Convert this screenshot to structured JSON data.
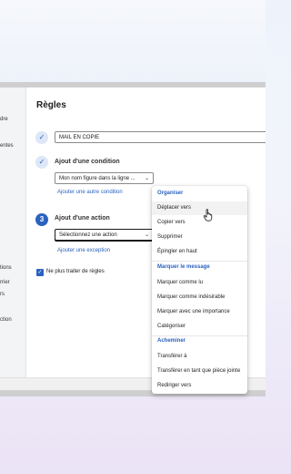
{
  "page": {
    "title": "Règles"
  },
  "left_pane": {
    "fragments": [
      "dre",
      "entes",
      "tions",
      "rrier",
      "rs",
      "ction"
    ]
  },
  "rule_name": {
    "value": "MAIL EN COPIE"
  },
  "condition": {
    "label": "Ajout d'une condition",
    "selected": "Mon nom figure dans la ligne ...",
    "add_link": "Ajouter une autre condition"
  },
  "action": {
    "step_number": "3",
    "label": "Ajout d'une action",
    "placeholder": "Sélectionnez une action",
    "exception_link": "Ajouter une exception"
  },
  "stop_rules": {
    "label": "Ne plus traiter de règles",
    "checked": true
  },
  "dropdown": {
    "groups": [
      {
        "header": "Organiser",
        "items": [
          "Déplacer vers",
          "Copier vers",
          "Supprimer",
          "Épingler en haut"
        ]
      },
      {
        "header": "Marquer le message",
        "items": [
          "Marquer comme lu",
          "Marquer comme indésirable",
          "Marquer avec une importance",
          "Catégoriser"
        ]
      },
      {
        "header": "Acheminer",
        "items": [
          "Transférer à",
          "Transférer en tant que pièce jointe",
          "Rediriger vers"
        ]
      }
    ],
    "hovered": "Déplacer vers"
  },
  "colors": {
    "accent": "#2b62c0",
    "check_bg": "#dde7f7"
  }
}
